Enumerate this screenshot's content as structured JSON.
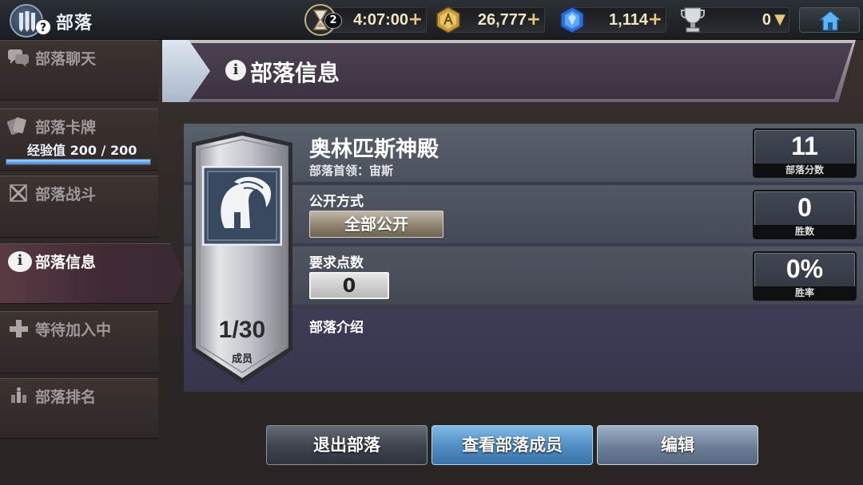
{
  "topbar": {
    "title": "部落",
    "help": "?",
    "timer": {
      "badge": "2",
      "value": "4:07:00",
      "plus": "+"
    },
    "gold": {
      "value": "26,777",
      "plus": "+"
    },
    "gems": {
      "value": "1,114",
      "plus": "+"
    },
    "trophy": {
      "value": "0",
      "arrow": "▼"
    }
  },
  "sidebar": {
    "items": [
      {
        "label": "部落聊天",
        "icon": "chat-icon"
      },
      {
        "label": "部落卡牌",
        "icon": "cards-icon",
        "xp_text": "经验值 200 / 200",
        "xp_progress": 1.0
      },
      {
        "label": "部落战斗",
        "icon": "crossed-swords-icon"
      },
      {
        "label": "部落信息",
        "icon": "info-icon",
        "active": true
      },
      {
        "label": "等待加入中",
        "icon": "plus-icon"
      },
      {
        "label": "部落排名",
        "icon": "ranking-icon"
      }
    ]
  },
  "header": {
    "title": "部落信息",
    "icon": "i"
  },
  "clan": {
    "name": "奥林匹斯神殿",
    "leader": "部落首领：宙斯",
    "members": "1/30",
    "members_label": "成员",
    "open_label": "公开方式",
    "open_value": "全部公开",
    "points_label": "要求点数",
    "points_value": "0",
    "intro_label": "部落介绍"
  },
  "stats": [
    {
      "value": "11",
      "caption": "部落分数"
    },
    {
      "value": "0",
      "caption": "胜数"
    },
    {
      "value": "0%",
      "caption": "胜率"
    }
  ],
  "buttons": {
    "leave": "退出部落",
    "members": "查看部落成员",
    "edit": "编辑"
  }
}
